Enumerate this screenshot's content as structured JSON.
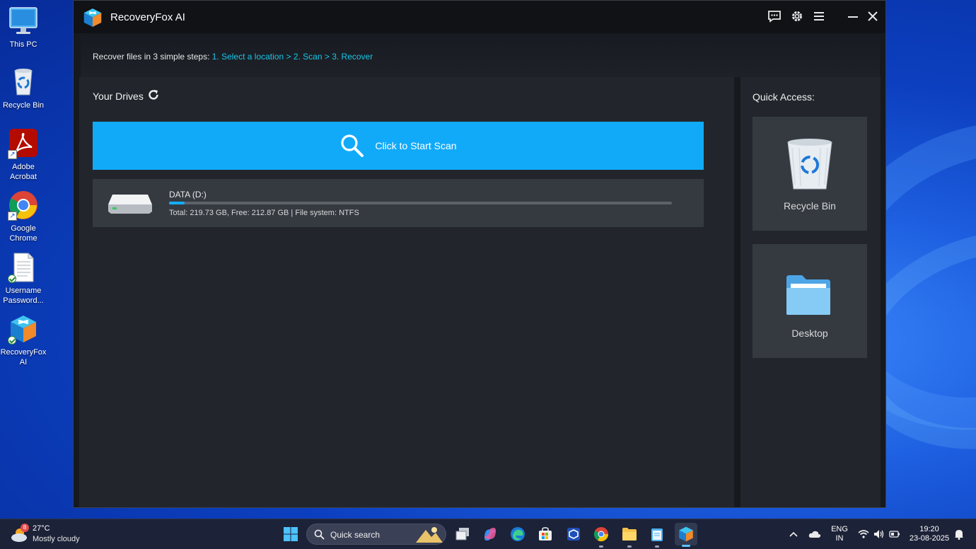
{
  "desktop": {
    "icons": [
      {
        "label": "This PC"
      },
      {
        "label": "Recycle Bin"
      },
      {
        "label": "Adobe Acrobat"
      },
      {
        "label": "Google Chrome"
      },
      {
        "label": "Username Password..."
      },
      {
        "label": "RecoveryFox AI"
      }
    ]
  },
  "window": {
    "title": "RecoveryFox AI",
    "steps_prefix": "Recover files in 3 simple steps:",
    "steps_highlight": "1. Select a location > 2. Scan > 3. Recover"
  },
  "drives": {
    "heading": "Your Drives",
    "scan_label": "Click to Start Scan",
    "items": [
      {
        "name": "DATA (D:)",
        "info": "Total: 219.73 GB, Free: 212.87 GB | File system: NTFS",
        "used_fraction": 0.031
      }
    ]
  },
  "quick_access": {
    "heading": "Quick Access:",
    "items": [
      {
        "label": "Recycle Bin",
        "icon": "recycle-bin-icon"
      },
      {
        "label": "Desktop",
        "icon": "folder-icon"
      }
    ]
  },
  "taskbar": {
    "weather_badge": "8",
    "temperature": "27°C",
    "weather_text": "Mostly cloudy",
    "search_placeholder": "Quick search",
    "language": "ENG",
    "region": "IN",
    "time": "19:20",
    "date": "23-08-2025"
  },
  "colors": {
    "accent": "#11aaf9",
    "steps_highlight": "#19c4e6",
    "panel": "#22262c",
    "card": "#353a41"
  }
}
